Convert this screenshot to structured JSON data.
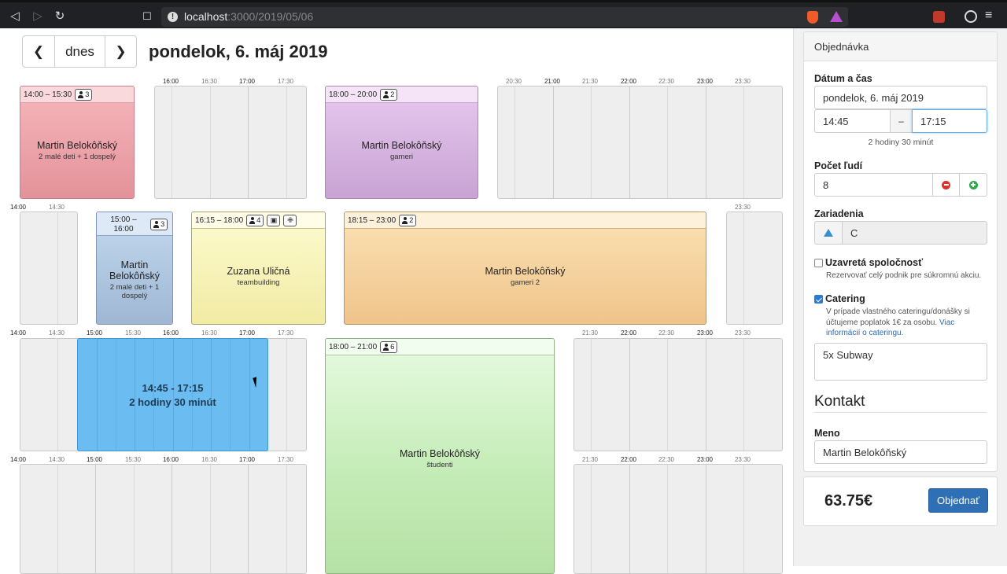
{
  "browser": {
    "url_host": "localhost",
    "url_path": ":3000/2019/05/06"
  },
  "toolbar": {
    "today_label": "dnes",
    "title": "pondelok, 6. máj 2019"
  },
  "ticks": {
    "t1400": "14:00",
    "t1430": "14:30",
    "t1500": "15:00",
    "t1530": "15:30",
    "t1600": "16:00",
    "t1630": "16:30",
    "t1700": "17:00",
    "t1730": "17:30",
    "t2030": "20:30",
    "t2100": "21:00",
    "t2130": "21:30",
    "t2200": "22:00",
    "t2230": "22:30",
    "t2300": "23:00",
    "t2330": "23:30"
  },
  "reservations": [
    {
      "time": "14:00 – 15:30",
      "people": "3",
      "name": "Martin Belokôňský",
      "desc": "2 malé deti + 1 dospelý"
    },
    {
      "time": "18:00 – 20:00",
      "people": "2",
      "name": "Martin Belokôňský",
      "desc": "gameri"
    },
    {
      "time": "15:00 – 16:00",
      "people": "3",
      "name": "Martin Belokôňský",
      "desc": "2 malé deti + 1 dospelý"
    },
    {
      "time": "16:15 – 18:00",
      "people": "4",
      "name": "Zuzana Uličná",
      "desc": "teambuilding"
    },
    {
      "time": "18:15 – 23:00",
      "people": "2",
      "name": "Martin Belokôňský",
      "desc": "gameri 2"
    },
    {
      "time": "18:00 – 21:00",
      "people": "6",
      "name": "Martin Belokôňský",
      "desc": "študenti"
    }
  ],
  "selection": {
    "range": "14:45 - 17:15",
    "duration": "2 hodiny 30 minút"
  },
  "colors": {
    "res0": "#f2a9ae",
    "res1": "#ddb9e6",
    "res2": "#b3cbe6",
    "res3": "#fbf8bf",
    "res4": "#f8d6a2",
    "res5": "#cdf3c3",
    "selection": "#6bbcf0"
  },
  "order": {
    "heading": "Objednávka",
    "datetime_label": "Dátum a čas",
    "date_value": "pondelok, 6. máj 2019",
    "dash": "–",
    "time_from": "14:45",
    "time_to": "17:15",
    "duration": "2 hodiny 30 minút",
    "people_label": "Počet ľudí",
    "people_value": "8",
    "facilities_label": "Zariadenia",
    "facilities_value": "C",
    "private_label": "Uzavretá spoločnosť",
    "private_checked": false,
    "private_help": "Rezervovať celý podnik pre súkromnú akciu.",
    "catering_label": "Catering",
    "catering_checked": true,
    "catering_help": "V prípade vlastného cateringu/donášky si účtujeme poplatok 1€ za osobu.",
    "catering_link": "Viac informácií o cateringu.",
    "catering_note": "5x Subway",
    "contact_heading": "Kontakt",
    "name_label": "Meno",
    "name_value": "Martin Belokôňský",
    "total": "63.75€",
    "order_button": "Objednať"
  }
}
